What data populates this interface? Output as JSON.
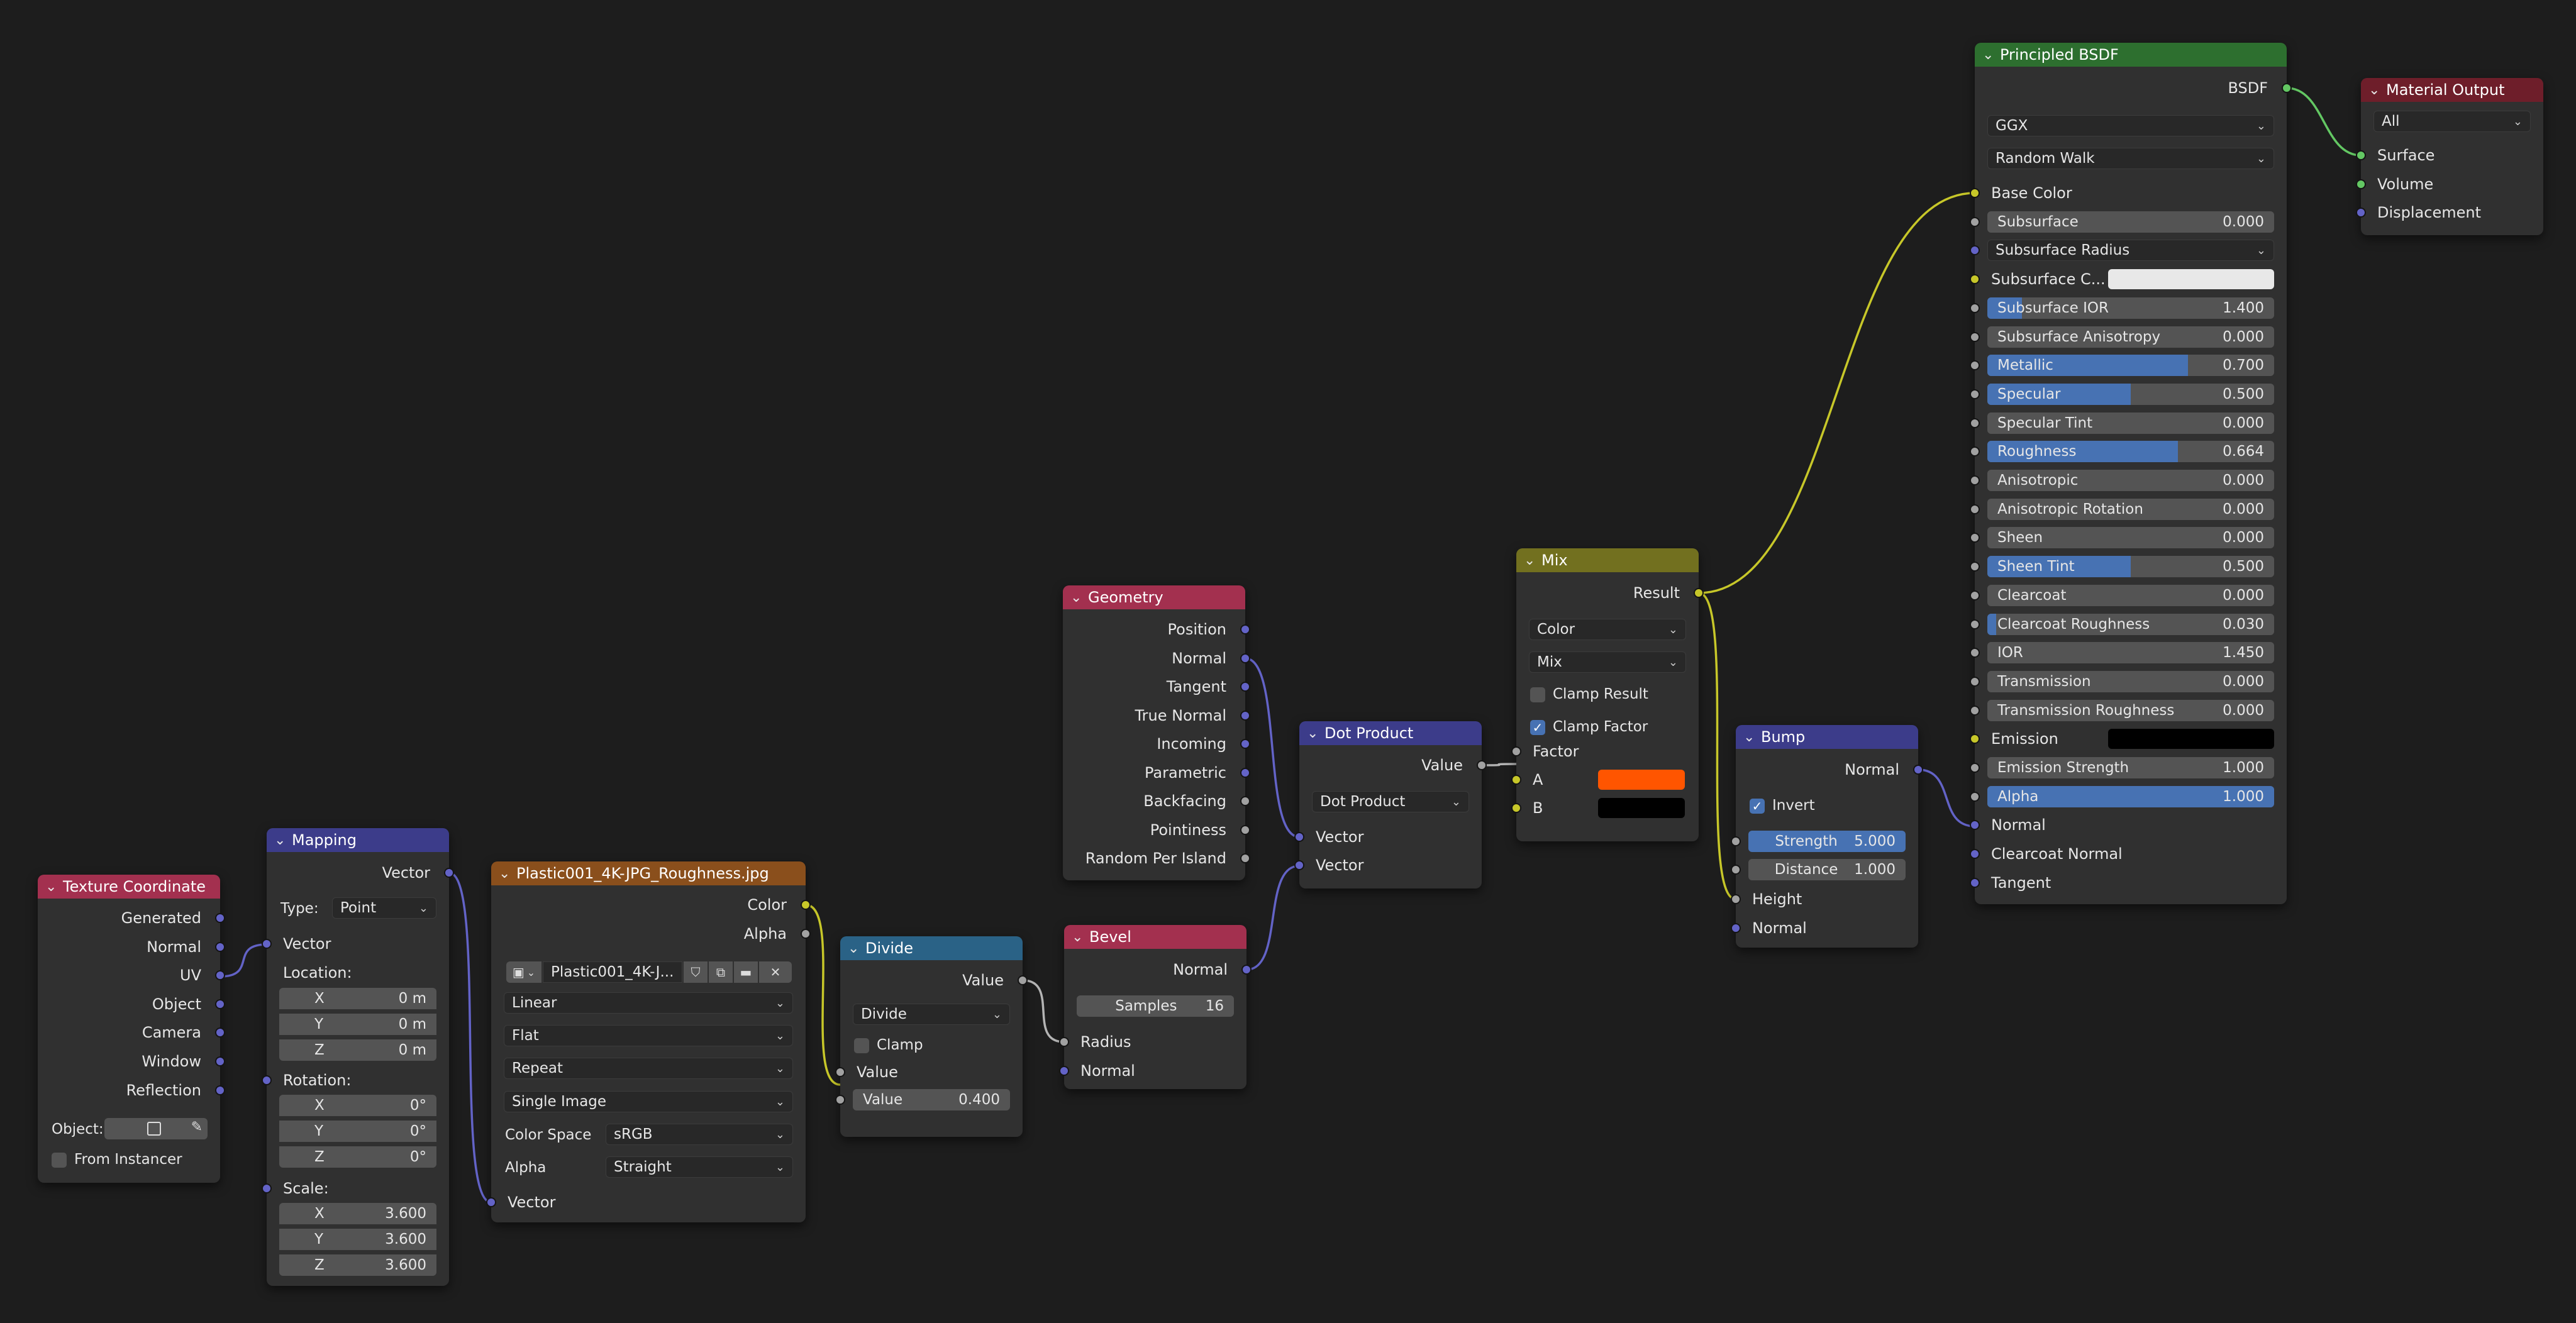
{
  "colors": {
    "header_input": "#a3304f",
    "header_vector": "#3c3c8a",
    "header_texture": "#8a4f1c",
    "header_converter": "#2a6286",
    "header_color": "#72701f",
    "header_shader": "#2d6f2f",
    "header_output": "#6e1e2a",
    "socket_vector": "#6363c7",
    "socket_color": "#c7c729",
    "socket_float": "#a1a1a1",
    "socket_shader": "#63c763",
    "accent": "#4772b3",
    "swatch_orange": "#ff5500",
    "swatch_black": "#000000",
    "swatch_white": "#e8e8e8"
  },
  "texcoord": {
    "title": "Texture Coordinate",
    "outputs": [
      "Generated",
      "Normal",
      "UV",
      "Object",
      "Camera",
      "Window",
      "Reflection"
    ],
    "object_label": "Object:",
    "from_instancer": "From Instancer"
  },
  "mapping": {
    "title": "Mapping",
    "out": "Vector",
    "type_label": "Type:",
    "type_value": "Point",
    "vector": "Vector",
    "location": "Location:",
    "rotation": "Rotation:",
    "scale": "Scale:",
    "loc": [
      {
        "a": "X",
        "v": "0 m"
      },
      {
        "a": "Y",
        "v": "0 m"
      },
      {
        "a": "Z",
        "v": "0 m"
      }
    ],
    "rot": [
      {
        "a": "X",
        "v": "0°"
      },
      {
        "a": "Y",
        "v": "0°"
      },
      {
        "a": "Z",
        "v": "0°"
      }
    ],
    "scl": [
      {
        "a": "X",
        "v": "3.600"
      },
      {
        "a": "Y",
        "v": "3.600"
      },
      {
        "a": "Z",
        "v": "3.600"
      }
    ]
  },
  "image": {
    "title": "Plastic001_4K-JPG_Roughness.jpg",
    "color": "Color",
    "alpha": "Alpha",
    "file": "Plastic001_4K-J...",
    "interp": "Linear",
    "proj": "Flat",
    "ext": "Repeat",
    "source": "Single Image",
    "cs_label": "Color Space",
    "cs_value": "sRGB",
    "alpha_label": "Alpha",
    "alpha_value": "Straight",
    "vector": "Vector"
  },
  "divide": {
    "title": "Divide",
    "value_out": "Value",
    "op": "Divide",
    "clamp": "Clamp",
    "value_in": "Value",
    "field_label": "Value",
    "field_value": "0.400"
  },
  "geometry": {
    "title": "Geometry",
    "outputs": [
      "Position",
      "Normal",
      "Tangent",
      "True Normal",
      "Incoming",
      "Parametric",
      "Backfacing",
      "Pointiness",
      "Random Per Island"
    ]
  },
  "bevel": {
    "title": "Bevel",
    "normal_out": "Normal",
    "samples_label": "Samples",
    "samples_value": "16",
    "radius": "Radius",
    "normal_in": "Normal"
  },
  "dot": {
    "title": "Dot Product",
    "value_out": "Value",
    "op": "Dot Product",
    "in1": "Vector",
    "in2": "Vector"
  },
  "mix": {
    "title": "Mix",
    "result": "Result",
    "type": "Color",
    "blend": "Mix",
    "clamp_result": "Clamp Result",
    "clamp_factor": "Clamp Factor",
    "factor": "Factor",
    "a": "A",
    "b": "B"
  },
  "bump": {
    "title": "Bump",
    "normal_out": "Normal",
    "invert": "Invert",
    "strength_label": "Strength",
    "strength_value": "5.000",
    "distance_label": "Distance",
    "distance_value": "1.000",
    "height": "Height",
    "normal_in": "Normal"
  },
  "bsdf": {
    "title": "Principled BSDF",
    "out": "BSDF",
    "dist": "GGX",
    "sss_method": "Random Walk",
    "base_color": "Base Color",
    "ssr": "Subsurface Radius",
    "ssc": "Subsurface C...",
    "emission": "Emission",
    "normal": "Normal",
    "cc_normal": "Clearcoat Normal",
    "tangent": "Tangent",
    "fields": [
      {
        "l": "Subsurface",
        "v": "0.000",
        "f": 0
      },
      {
        "l": "Subsurface IOR",
        "v": "1.400",
        "f": 0.12
      },
      {
        "l": "Subsurface Anisotropy",
        "v": "0.000",
        "f": 0
      },
      {
        "l": "Metallic",
        "v": "0.700",
        "f": 0.7
      },
      {
        "l": "Specular",
        "v": "0.500",
        "f": 0.5
      },
      {
        "l": "Specular Tint",
        "v": "0.000",
        "f": 0
      },
      {
        "l": "Roughness",
        "v": "0.664",
        "f": 0.664
      },
      {
        "l": "Anisotropic",
        "v": "0.000",
        "f": 0
      },
      {
        "l": "Anisotropic Rotation",
        "v": "0.000",
        "f": 0
      },
      {
        "l": "Sheen",
        "v": "0.000",
        "f": 0
      },
      {
        "l": "Sheen Tint",
        "v": "0.500",
        "f": 0.5
      },
      {
        "l": "Clearcoat",
        "v": "0.000",
        "f": 0
      },
      {
        "l": "Clearcoat Roughness",
        "v": "0.030",
        "f": 0.03
      },
      {
        "l": "IOR",
        "v": "1.450",
        "f": 0
      },
      {
        "l": "Transmission",
        "v": "0.000",
        "f": 0
      },
      {
        "l": "Transmission Roughness",
        "v": "0.000",
        "f": 0
      }
    ],
    "tail_fields": [
      {
        "l": "Emission Strength",
        "v": "1.000",
        "f": 0
      },
      {
        "l": "Alpha",
        "v": "1.000",
        "f": 1
      }
    ]
  },
  "output": {
    "title": "Material Output",
    "target": "All",
    "surface": "Surface",
    "volume": "Volume",
    "displacement": "Displacement"
  }
}
